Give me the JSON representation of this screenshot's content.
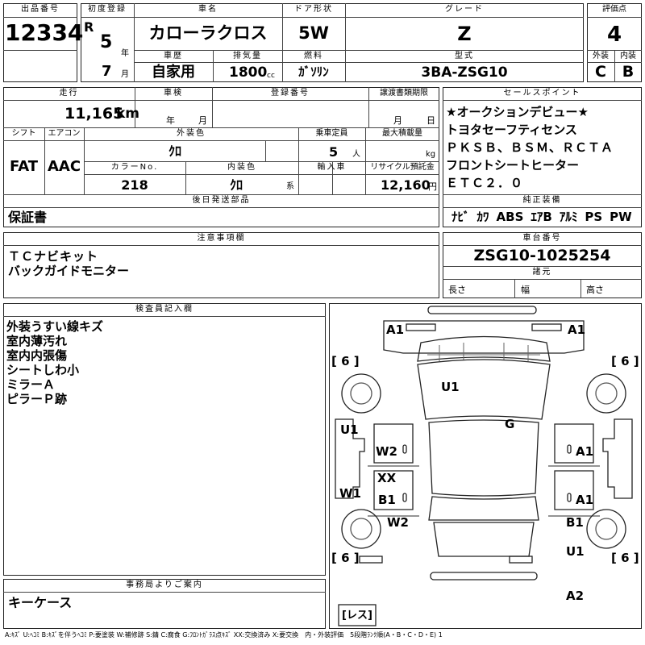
{
  "labels": {
    "lot_no": "出品番号",
    "first_reg": "初度登録",
    "car_name": "車名",
    "door": "ドア形状",
    "grade": "グレード",
    "score": "評価点",
    "history": "車歴",
    "displacement": "排気量",
    "fuel": "燃料",
    "model": "型式",
    "exterior": "外装",
    "interior": "内装",
    "mileage": "走行",
    "inspection": "車検",
    "reg_no": "登録番号",
    "transfer_deadline": "譲渡書類期限",
    "sales_point": "セールスポイント",
    "shift": "シフト",
    "aircon": "エアコン",
    "ext_color": "外装色",
    "capacity": "乗車定員",
    "max_load": "最大積載量",
    "color_no": "カラーNo.",
    "int_color": "内装色",
    "import": "輸入車",
    "recycle": "リサイクル預託金",
    "later_items": "後日発送部品",
    "equipment": "純正装備",
    "notes": "注意事項欄",
    "chassis": "車台番号",
    "dimensions": "諸元",
    "length": "長さ",
    "width": "幅",
    "height": "高さ",
    "inspector": "検査員記入欄",
    "office": "事務局よりご案内"
  },
  "units": {
    "year": "年",
    "month": "月",
    "cc": "cc",
    "km": "km",
    "persons": "人",
    "kg": "kg",
    "yen": "円",
    "kei": "系"
  },
  "vehicle": {
    "lot_no": "12334",
    "era": "R",
    "reg_year": "5",
    "reg_month": "7",
    "car_name": "カローラクロス",
    "door": "5W",
    "grade": "Z",
    "score": "4",
    "history": "自家用",
    "displacement": "1800",
    "fuel": "ｶﾞｿﾘﾝ",
    "model": "3BA-ZSG10",
    "exterior_grade": "C",
    "interior_grade": "B",
    "mileage": "11,165",
    "shift": "FAT",
    "aircon": "AAC",
    "ext_color": "ｸﾛ",
    "capacity": "5",
    "color_no": "218",
    "int_color": "ｸﾛ",
    "recycle": "12,160",
    "chassis": "ZSG10-1025254"
  },
  "sales_points": [
    "★オークションデビュー★",
    "トヨタセーフティセンス",
    "ＰＫＳＢ、ＢＳＭ、ＲＣＴＡ",
    "フロントシートヒーター",
    "ＥＴＣ２．０"
  ],
  "equipment": [
    "ﾅﾋﾞ",
    "ｶﾜ",
    "ABS",
    "ｴｱB",
    "ｱﾙﾐ",
    "PS",
    "PW"
  ],
  "later_items": "保証書",
  "notes": [
    "ＴＣナビキット",
    "バックガイドモニター"
  ],
  "inspector_notes": [
    "外装うすい線キズ",
    "室内薄汚れ",
    "室内内張傷",
    "シートしわ小",
    "ミラーＡ",
    "ピラーＰ跡"
  ],
  "office_note": "キーケース",
  "damage": {
    "front_left": "A1",
    "front_right": "A1",
    "tire_fl": "6",
    "tire_fr": "6",
    "tire_rl": "6",
    "tire_rr": "6",
    "roof": "U1",
    "windshield": "G",
    "left_fender": "U1",
    "left_front_door": "W2",
    "left_mid": "XX",
    "left_rear_door": "B1",
    "left_sill": "W1",
    "left_quarter": "W2",
    "right_front_door": "A1",
    "right_rear_door": "A1",
    "right_quarter": "B1",
    "right_rear": "U1",
    "rear_bumper": "A2",
    "spare": "レス"
  },
  "legend": "A:ｷｽﾞ U:ﾍｺﾐ B:ｷｽﾞを伴うﾍｺﾐ P:要塗装 W:補修跡 S:錆 C:腐食 G:ﾌﾛﾝﾄｶﾞﾗｽ点ｷｽﾞ XX:交換済み X:要交換　内・外装評価　5段階ﾗﾝｸ順(A・B・C・D・E) 1"
}
